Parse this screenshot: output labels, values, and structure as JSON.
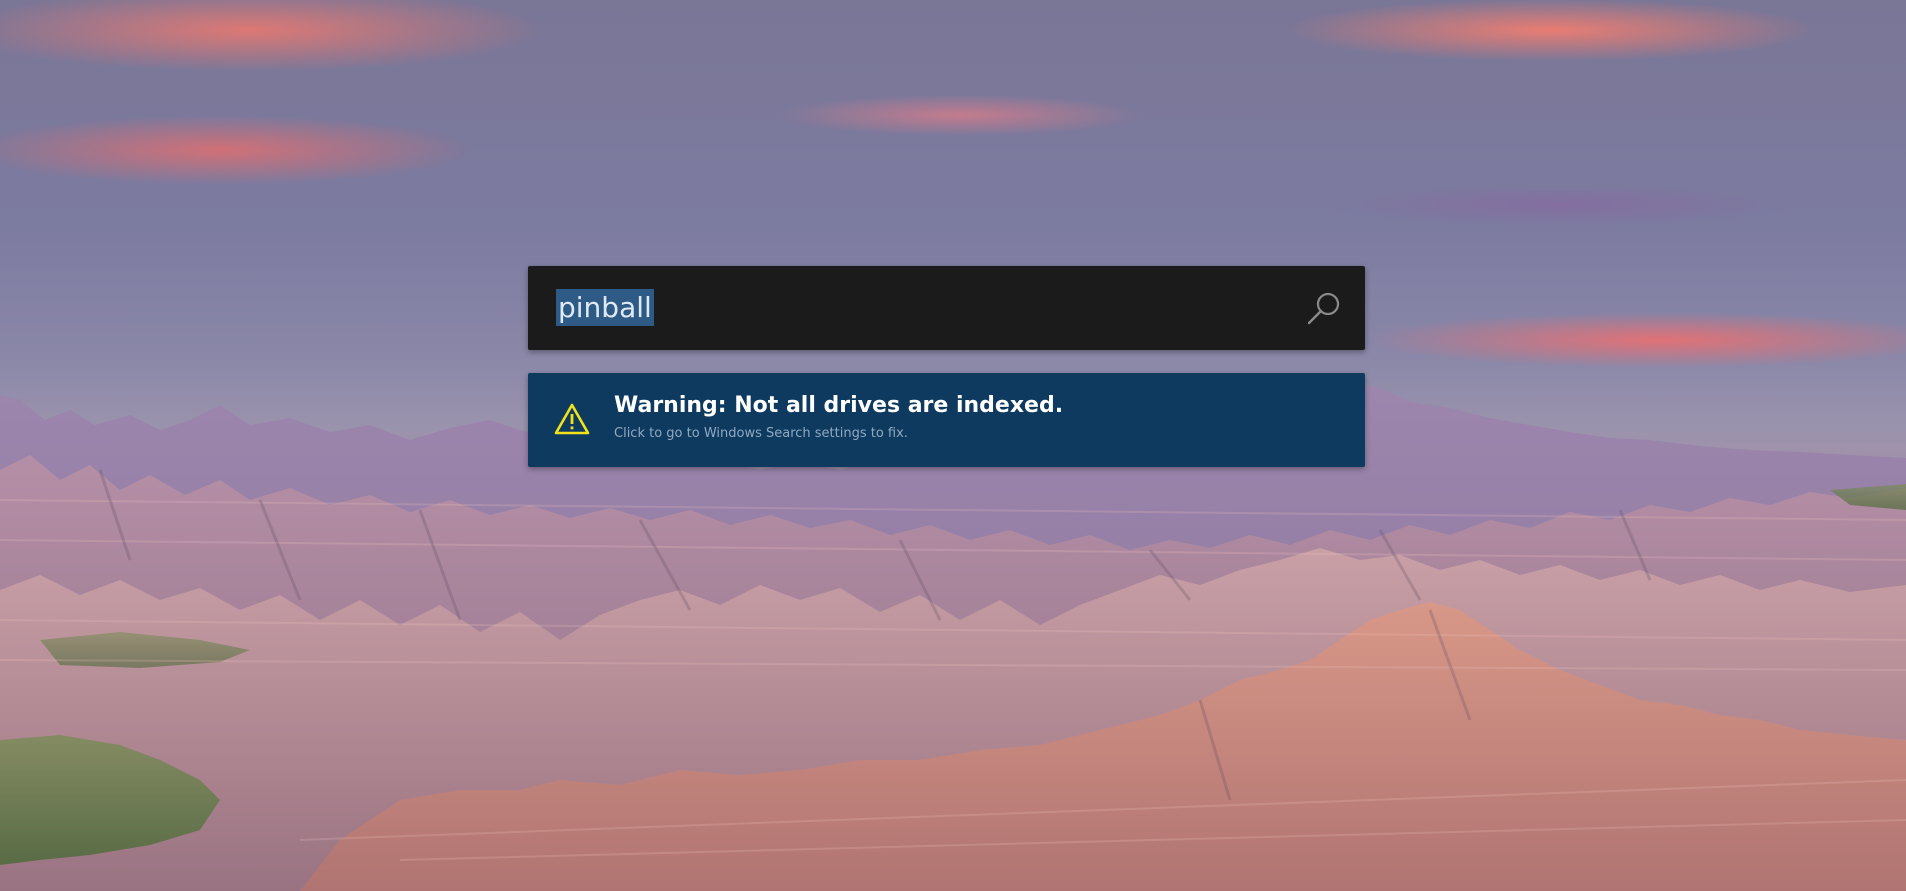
{
  "search": {
    "query": "pinball",
    "icon": "search-icon"
  },
  "warning": {
    "icon": "warning-triangle-icon",
    "title": "Warning: Not all drives are indexed.",
    "subtitle": "Click to go to Windows Search settings to fix.",
    "accent_color": "#0f3a5f",
    "icon_color": "#f2e21a"
  },
  "wallpaper": {
    "description_icon": "badlands-landscape-background"
  }
}
